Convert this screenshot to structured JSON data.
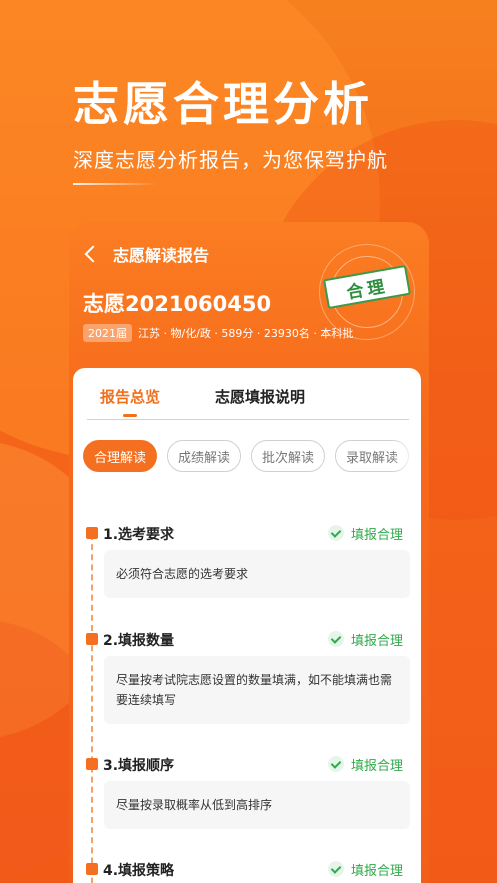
{
  "headline": "志愿合理分析",
  "subline": "深度志愿分析报告，为您保驾护航",
  "phone": {
    "nav_title": "志愿解读报告",
    "report_id": "志愿2021060450",
    "year_badge": "2021届",
    "meta_text": "江苏 · 物/化/政 · 589分 · 23930名 · 本科批",
    "stamp": "合理",
    "tabs": [
      {
        "label": "报告总览",
        "active": true
      },
      {
        "label": "志愿填报说明",
        "active": false
      }
    ],
    "chips": [
      {
        "label": "合理解读",
        "active": true
      },
      {
        "label": "成绩解读",
        "active": false
      },
      {
        "label": "批次解读",
        "active": false
      },
      {
        "label": "录取解读",
        "active": false
      }
    ],
    "sections": [
      {
        "title": "1.选考要求",
        "status": "填报合理",
        "desc": "必须符合志愿的选考要求"
      },
      {
        "title": "2.填报数量",
        "status": "填报合理",
        "desc": "尽量按考试院志愿设置的数量填满，如不能填满也需要连续填写"
      },
      {
        "title": "3.填报顺序",
        "status": "填报合理",
        "desc": "尽量按录取概率从低到高排序"
      },
      {
        "title": "4.填报策略",
        "status": "填报合理",
        "desc": ""
      }
    ]
  },
  "colors": {
    "accent": "#f47020",
    "success": "#2faa4a"
  }
}
